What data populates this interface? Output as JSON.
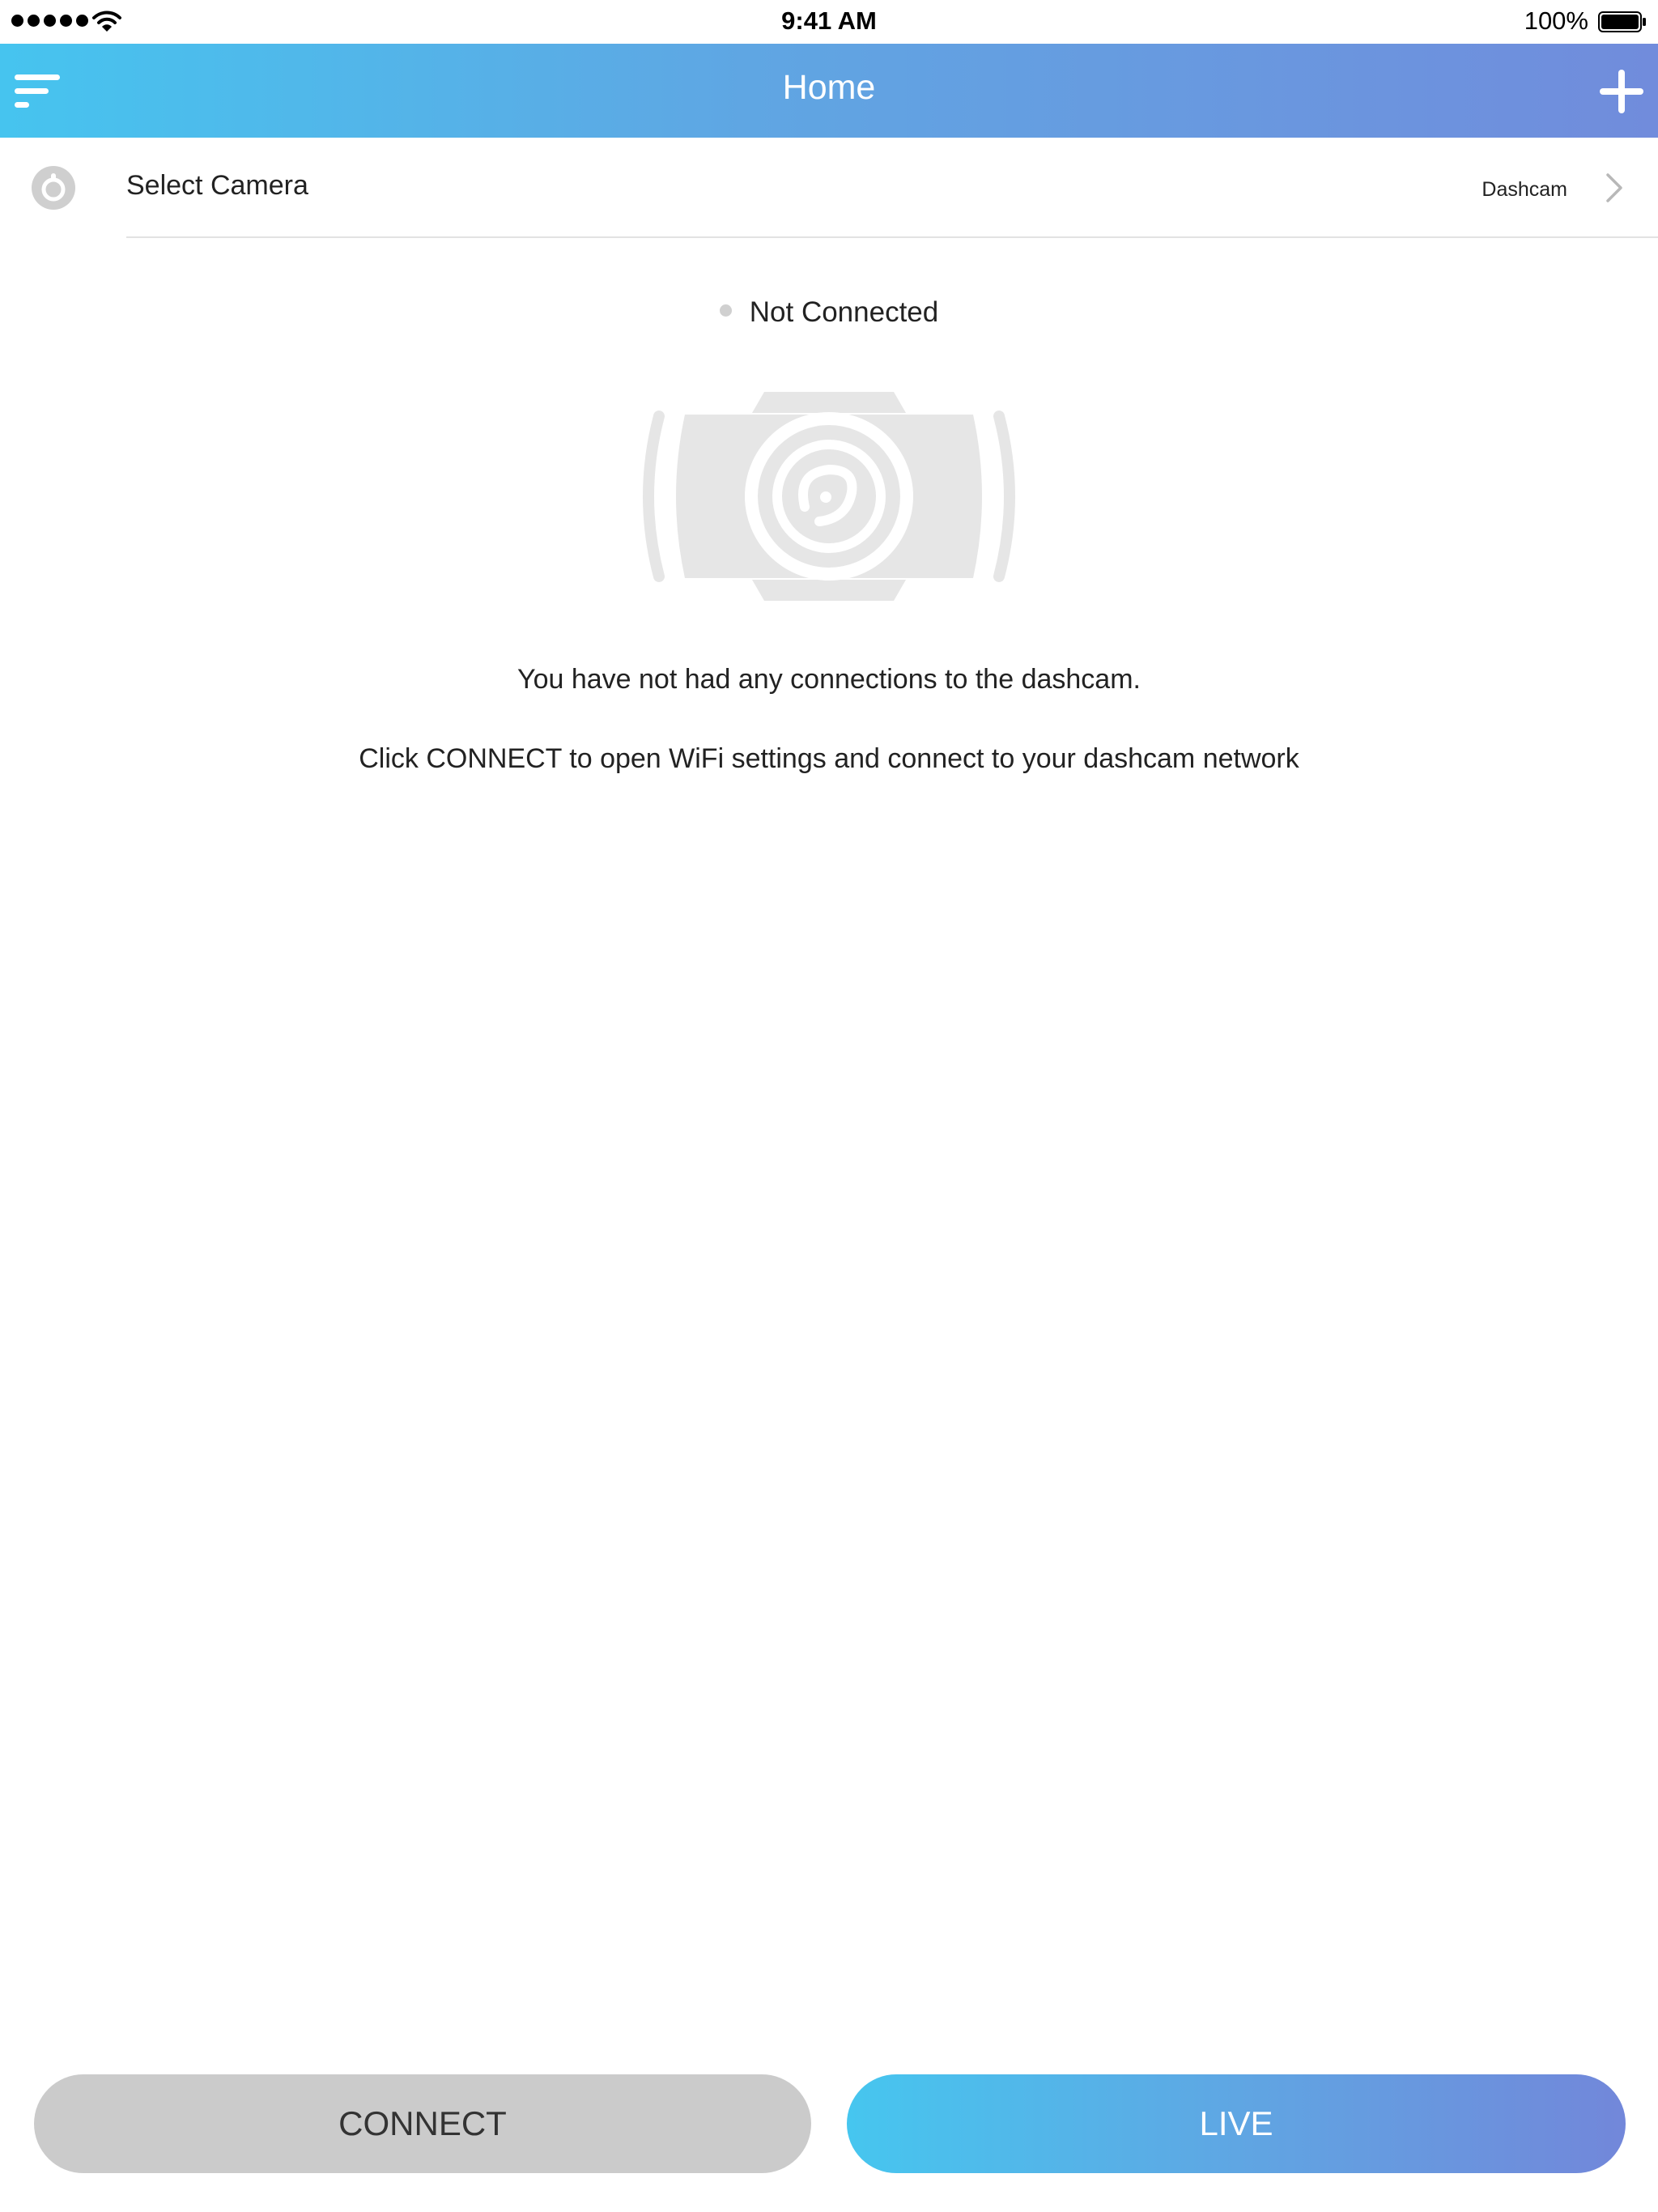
{
  "status_bar": {
    "time": "9:41 AM",
    "battery": "100%"
  },
  "nav": {
    "title": "Home"
  },
  "camera_select": {
    "label": "Select Camera",
    "value": "Dashcam"
  },
  "connection": {
    "status": "Not Connected"
  },
  "messages": {
    "line1": "You have not had any connections to the dashcam.",
    "line2": "Click CONNECT to open WiFi settings and connect to your dashcam network"
  },
  "buttons": {
    "connect": "CONNECT",
    "live": "LIVE"
  },
  "colors": {
    "gradient_start": "#46c4ef",
    "gradient_end": "#718cdc",
    "connect_button": "#cbcbcb",
    "status_dot": "#d0d0d0"
  }
}
